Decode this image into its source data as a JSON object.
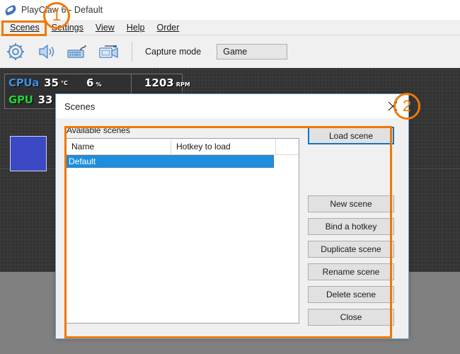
{
  "window": {
    "title": "PlayClaw 6 - Default",
    "app_icon": "playclaw-claw-icon"
  },
  "menubar": {
    "items": [
      {
        "label": "Scenes",
        "accel": "S"
      },
      {
        "label": "Settings",
        "accel": "S"
      },
      {
        "label": "View",
        "accel": "V"
      },
      {
        "label": "Help",
        "accel": "H"
      },
      {
        "label": "Order",
        "accel": "O"
      }
    ]
  },
  "toolbar": {
    "icons": [
      "gear-icon",
      "speaker-icon",
      "keyboard-icon",
      "video-camera-icon"
    ],
    "capture_mode_label": "Capture mode",
    "capture_mode_value": "Game"
  },
  "overlay_preview": {
    "stats": {
      "cpu_label": "CPUa",
      "cpu_temp": "35",
      "cpu_temp_unit": "°C",
      "cpu_load": "6",
      "cpu_load_unit": "%",
      "fan_rpm": "1203",
      "fan_rpm_unit": "RPM",
      "gpu_label": "GPU",
      "gpu_temp": "33"
    },
    "colors": {
      "cpu": "#3f8fe0",
      "gpu": "#24d13b",
      "canvas": "#333333",
      "blue_widget": "#3b49c4"
    }
  },
  "dialog": {
    "title": "Scenes",
    "close_icon": "close-x-icon",
    "group_label": "Available scenes",
    "columns": [
      "Name",
      "Hotkey to load"
    ],
    "rows": [
      {
        "name": "Default",
        "hotkey": "",
        "selected": true
      }
    ],
    "buttons": {
      "load": "Load scene",
      "new": "New scene",
      "bind": "Bind a hotkey",
      "duplicate": "Duplicate scene",
      "rename": "Rename scene",
      "delete": "Delete scene",
      "close": "Close"
    }
  },
  "annotations": {
    "badge_1": "1",
    "badge_2": "2",
    "color": "#f07800"
  }
}
